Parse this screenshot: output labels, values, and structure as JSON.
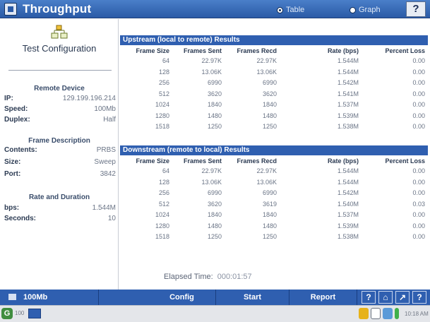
{
  "titlebar": {
    "title": "Throughput",
    "view_options": [
      {
        "label": "Table",
        "selected": true
      },
      {
        "label": "Graph",
        "selected": false
      }
    ],
    "help_label": "?"
  },
  "left": {
    "heading": "Test Configuration",
    "remote_device": {
      "title": "Remote Device",
      "ip_key": "IP:",
      "ip_value": "129.199.196.214",
      "speed_key": "Speed:",
      "speed_value": "100Mb",
      "duplex_key": "Duplex:",
      "duplex_value": "Half"
    },
    "frame_description": {
      "title": "Frame Description",
      "contents_key": "Contents:",
      "contents_value": "PRBS",
      "size_key": "Size:",
      "size_value": "Sweep",
      "port_key": "Port:",
      "port_value": "3842"
    },
    "rate_duration": {
      "title": "Rate and Duration",
      "bps_key": "bps:",
      "bps_value": "1.544M",
      "seconds_key": "Seconds:",
      "seconds_value": "10"
    }
  },
  "tables": {
    "columns": [
      "Frame Size",
      "Frames Sent",
      "Frames Recd",
      "Rate (bps)",
      "Percent Loss"
    ],
    "upstream": {
      "title": "Upstream (local to remote) Results",
      "rows": [
        [
          "64",
          "22.97K",
          "22.97K",
          "1.544M",
          "0.00"
        ],
        [
          "128",
          "13.06K",
          "13.06K",
          "1.544M",
          "0.00"
        ],
        [
          "256",
          "6990",
          "6990",
          "1.542M",
          "0.00"
        ],
        [
          "512",
          "3620",
          "3620",
          "1.541M",
          "0.00"
        ],
        [
          "1024",
          "1840",
          "1840",
          "1.537M",
          "0.00"
        ],
        [
          "1280",
          "1480",
          "1480",
          "1.539M",
          "0.00"
        ],
        [
          "1518",
          "1250",
          "1250",
          "1.538M",
          "0.00"
        ]
      ]
    },
    "downstream": {
      "title": "Downstream (remote to local) Results",
      "rows": [
        [
          "64",
          "22.97K",
          "22.97K",
          "1.544M",
          "0.00"
        ],
        [
          "128",
          "13.06K",
          "13.06K",
          "1.544M",
          "0.00"
        ],
        [
          "256",
          "6990",
          "6990",
          "1.542M",
          "0.00"
        ],
        [
          "512",
          "3620",
          "3619",
          "1.540M",
          "0.03"
        ],
        [
          "1024",
          "1840",
          "1840",
          "1.537M",
          "0.00"
        ],
        [
          "1280",
          "1480",
          "1480",
          "1.539M",
          "0.00"
        ],
        [
          "1518",
          "1250",
          "1250",
          "1.538M",
          "0.00"
        ]
      ]
    }
  },
  "elapsed": {
    "label": "Elapsed Time:",
    "value": "000:01:57"
  },
  "toolbar": {
    "speed_label": "100Mb",
    "config_label": "Config",
    "start_label": "Start",
    "report_label": "Report",
    "icon_names": [
      "question-icon",
      "home-icon",
      "tools-icon",
      "help-icon"
    ]
  },
  "status": {
    "left_text": "100",
    "time": "10:18 AM"
  }
}
